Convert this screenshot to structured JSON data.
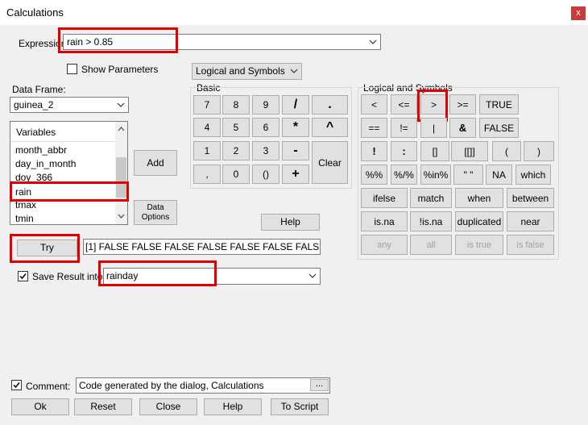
{
  "window": {
    "title": "Calculations",
    "close_glyph": "x"
  },
  "expression": {
    "label": "Expression",
    "value": "rain > 0.85"
  },
  "show_parameters": {
    "label": "Show Parameters",
    "checked": false
  },
  "keyboard_select": {
    "value": "Logical and Symbols"
  },
  "data_frame": {
    "label": "Data Frame:",
    "value": "guinea_2"
  },
  "variables": {
    "header": "Variables",
    "items": [
      "month_abbr",
      "day_in_month",
      "doy_366",
      "rain",
      "tmax",
      "tmin"
    ],
    "selected": "rain"
  },
  "buttons": {
    "add": "Add",
    "data_options": "Data Options",
    "help_small": "Help",
    "try": "Try",
    "ok": "Ok",
    "reset": "Reset",
    "close": "Close",
    "help": "Help",
    "to_script": "To Script",
    "ellipsis": "..."
  },
  "basic": {
    "title": "Basic",
    "keys": [
      "7",
      "8",
      "9",
      "/",
      ".",
      "4",
      "5",
      "6",
      "*",
      "^",
      "1",
      "2",
      "3",
      "-",
      "Clear",
      ",",
      "0",
      "()",
      "+"
    ]
  },
  "logical": {
    "title": "Logical and Symbols",
    "row1": [
      "<",
      "<=",
      ">",
      ">=",
      "TRUE"
    ],
    "row2": [
      "==",
      "!=",
      "|",
      "&",
      "FALSE"
    ],
    "row3": [
      "!",
      ":",
      "[]",
      "[[]]",
      "(",
      ")"
    ],
    "row4": [
      "%%",
      "%/%",
      "%in%",
      "\" \"",
      "NA",
      "which"
    ],
    "row5": [
      "ifelse",
      "match",
      "when",
      "between"
    ],
    "row6": [
      "is.na",
      "!is.na",
      "duplicated",
      "near"
    ],
    "row7": [
      "any",
      "all",
      "is true",
      "is false"
    ]
  },
  "try_result": "[1] FALSE FALSE FALSE FALSE FALSE FALSE FALSE FALS",
  "save_result": {
    "label": "Save Result into",
    "checked": true,
    "value": "rainday"
  },
  "comment": {
    "label": "Comment:",
    "checked": true,
    "value": "Code generated by the dialog, Calculations"
  },
  "highlight_color": "#e00000"
}
